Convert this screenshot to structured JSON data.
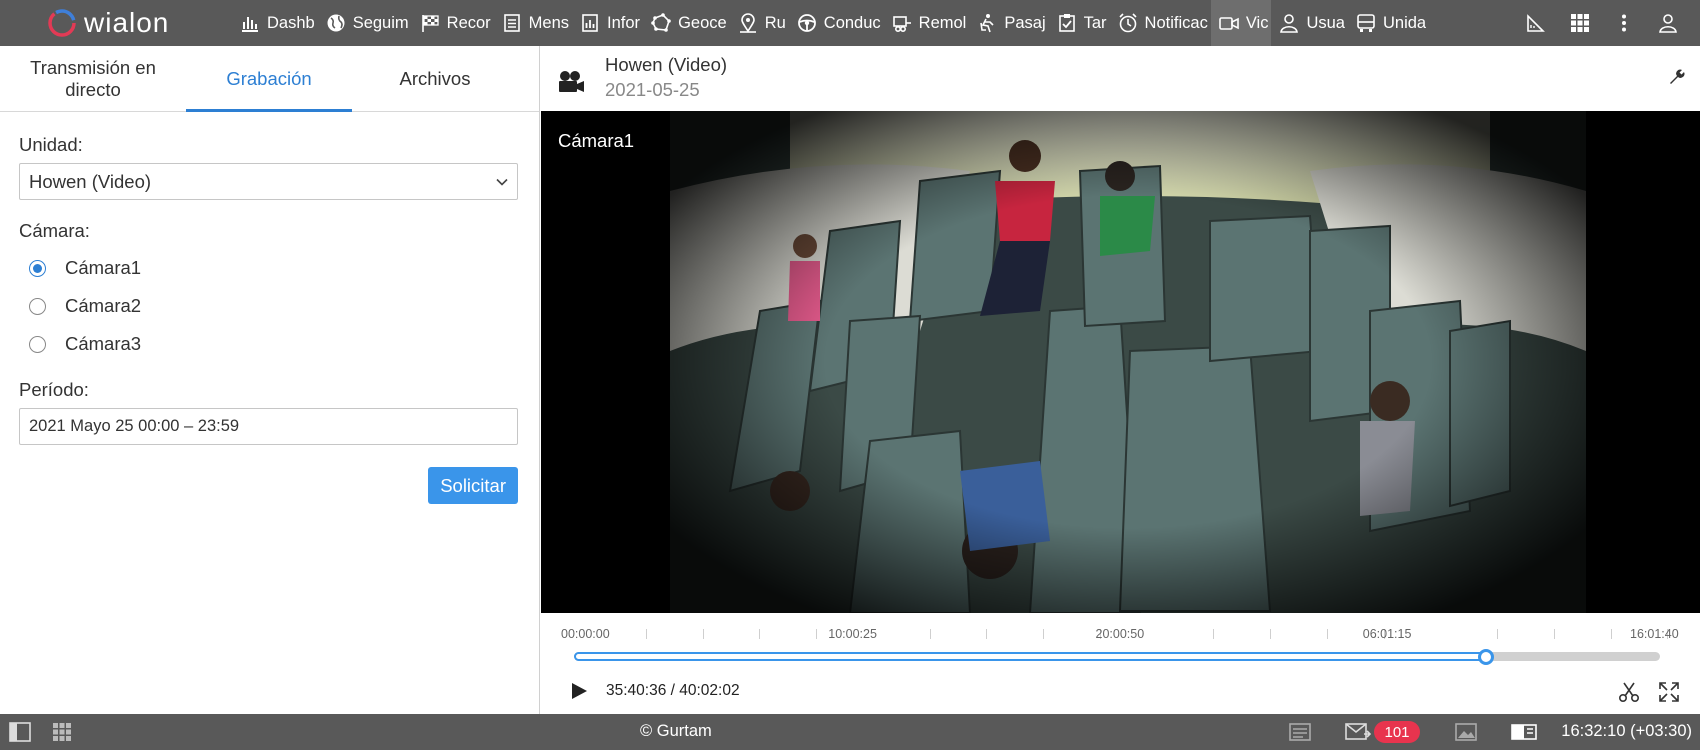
{
  "brand": {
    "name": "wialon"
  },
  "nav": [
    {
      "icon": "bar-chart-icon",
      "label": "Dashb"
    },
    {
      "icon": "globe-icon",
      "label": "Seguim"
    },
    {
      "icon": "checkered-flag-icon",
      "label": "Recor"
    },
    {
      "icon": "message-icon",
      "label": "Mens"
    },
    {
      "icon": "report-icon",
      "label": "Infor"
    },
    {
      "icon": "geofence-icon",
      "label": "Geoce"
    },
    {
      "icon": "route-icon",
      "label": "Ru"
    },
    {
      "icon": "steering-wheel-icon",
      "label": "Conduc"
    },
    {
      "icon": "trailer-icon",
      "label": "Remol"
    },
    {
      "icon": "passenger-icon",
      "label": "Pasaj"
    },
    {
      "icon": "task-icon",
      "label": "Tar"
    },
    {
      "icon": "alarm-icon",
      "label": "Notificac"
    },
    {
      "icon": "video-camera-icon",
      "label": "Vic",
      "active": true
    },
    {
      "icon": "user-icon",
      "label": "Usua"
    },
    {
      "icon": "bus-icon",
      "label": "Unida"
    }
  ],
  "tabs": {
    "live": "Transmisión en directo",
    "recording": "Grabación",
    "files": "Archivos"
  },
  "form": {
    "unit_label": "Unidad:",
    "unit_value": "Howen (Video)",
    "camera_label": "Cámara:",
    "cameras": [
      "Cámara1",
      "Cámara2",
      "Cámara3"
    ],
    "selected_camera": 0,
    "period_label": "Período:",
    "period_value": "2021 Mayo 25 00:00 – 23:59",
    "submit_label": "Solicitar"
  },
  "player": {
    "title": "Howen (Video)",
    "date": "2021-05-25",
    "camera_overlay": "Cámara1",
    "tick_labels": [
      "00:00:00",
      "10:00:25",
      "20:00:50",
      "06:01:15",
      "16:01:40"
    ],
    "progress_fraction": 0.84,
    "time_display": "35:40:36 / 40:02:02"
  },
  "status": {
    "copyright": "© Gurtam",
    "unread_count": "101",
    "clock": "16:32:10 (+03:30)"
  }
}
